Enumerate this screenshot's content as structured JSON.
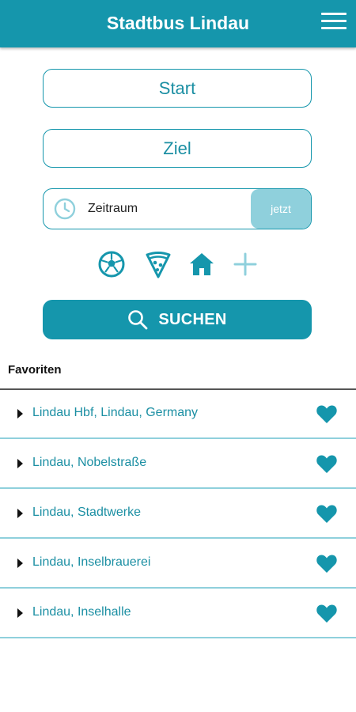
{
  "header": {
    "title": "Stadtbus Lindau",
    "menu_icon": "hamburger-menu-icon"
  },
  "form": {
    "start_label": "Start",
    "ziel_label": "Ziel",
    "time": {
      "icon": "clock-icon",
      "label": "Zeitraum",
      "now_button": "jetzt"
    }
  },
  "categories": [
    {
      "icon": "soccer-ball-icon"
    },
    {
      "icon": "pizza-icon"
    },
    {
      "icon": "home-icon"
    },
    {
      "icon": "plus-icon"
    }
  ],
  "search": {
    "icon": "search-icon",
    "label": "SUCHEN"
  },
  "favorites": {
    "title": "Favoriten",
    "items": [
      {
        "label": "Lindau Hbf, Lindau, Germany"
      },
      {
        "label": "Lindau, Nobelstraße"
      },
      {
        "label": "Lindau, Stadtwerke"
      },
      {
        "label": "Lindau, Inselbrauerei"
      },
      {
        "label": "Lindau, Inselhalle"
      }
    ]
  },
  "colors": {
    "accent": "#1596ac",
    "accent_light": "#8fd0dc",
    "text_accent": "#1b8fa3"
  }
}
